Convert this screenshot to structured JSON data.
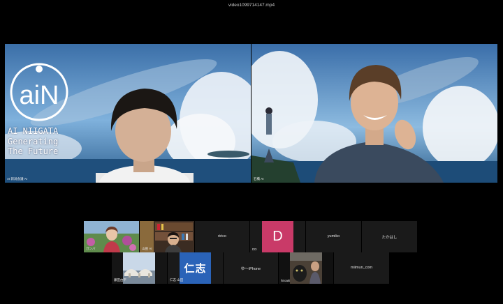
{
  "window": {
    "file_title": "video1099714147.mp4"
  },
  "speakers": [
    {
      "name": "AI 新潟会議 AI",
      "logo_text": "aiN",
      "tagline": "AI NIIGATA\nGenerating\nThe Future"
    },
    {
      "name": "石橋 AI"
    }
  ],
  "gallery": {
    "row1": [
      {
        "name": "ガンバ",
        "type": "video"
      },
      {
        "name": "山田 AI",
        "type": "video"
      },
      {
        "name": "ririco",
        "type": "name"
      },
      {
        "name": "DD",
        "type": "avatar",
        "initial": "D"
      },
      {
        "name": "yumiko",
        "type": "name"
      },
      {
        "name": "たかはし",
        "type": "name"
      }
    ],
    "row2": [
      {
        "name": "藤田由平",
        "type": "video"
      },
      {
        "name": "仁志 山田",
        "type": "avatar",
        "initial": "仁志"
      },
      {
        "name": "ゆ〜iPhone",
        "type": "name"
      },
      {
        "name": "hiroaki",
        "type": "video"
      },
      {
        "name": "miimun_com",
        "type": "name"
      }
    ]
  }
}
